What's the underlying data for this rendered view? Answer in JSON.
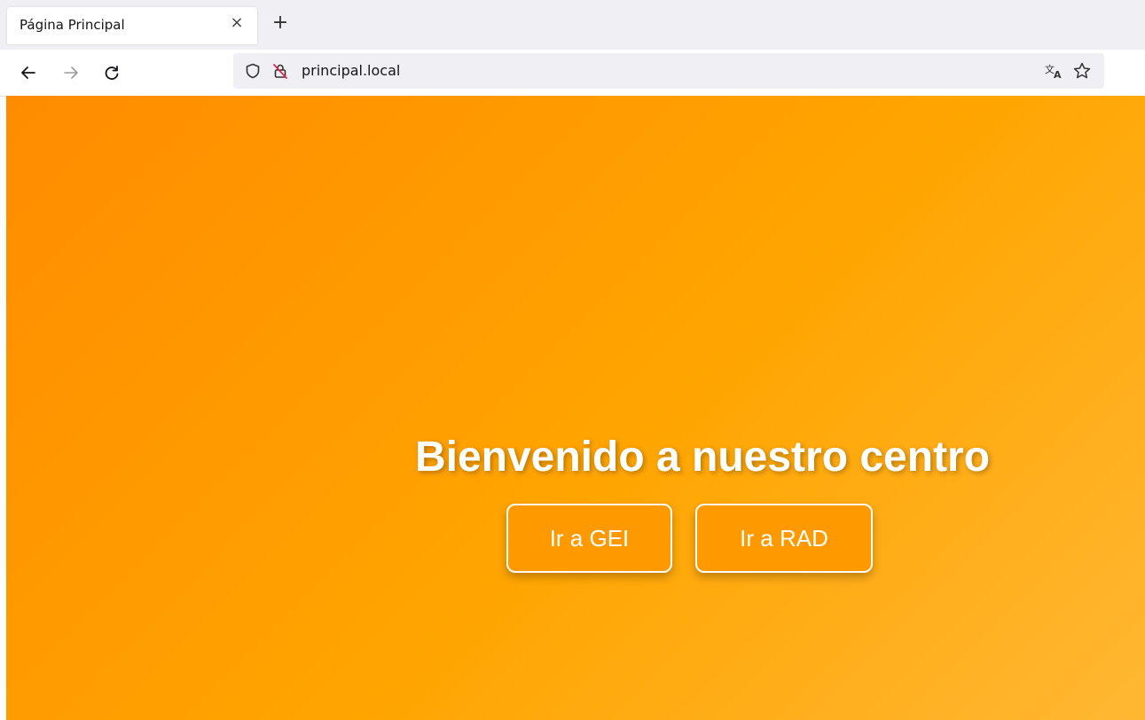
{
  "browser": {
    "tab": {
      "title": "Página Principal",
      "close_symbol": "×"
    },
    "new_tab_symbol": "+",
    "url": "principal.local",
    "icons": {
      "back": "arrow-left-icon",
      "forward": "arrow-right-icon",
      "reload": "reload-icon",
      "shield": "shield-icon",
      "insecure_lock": "insecure-lock-icon",
      "translate": "translate-icon",
      "bookmark": "star-icon"
    }
  },
  "page": {
    "heading": "Bienvenido a nuestro centro",
    "buttons": [
      {
        "label": "Ir a GEI"
      },
      {
        "label": "Ir a RAD"
      }
    ],
    "colors": {
      "gradient_start": "#ff8c00",
      "gradient_end": "#ffb733",
      "text": "#ffffff"
    }
  }
}
